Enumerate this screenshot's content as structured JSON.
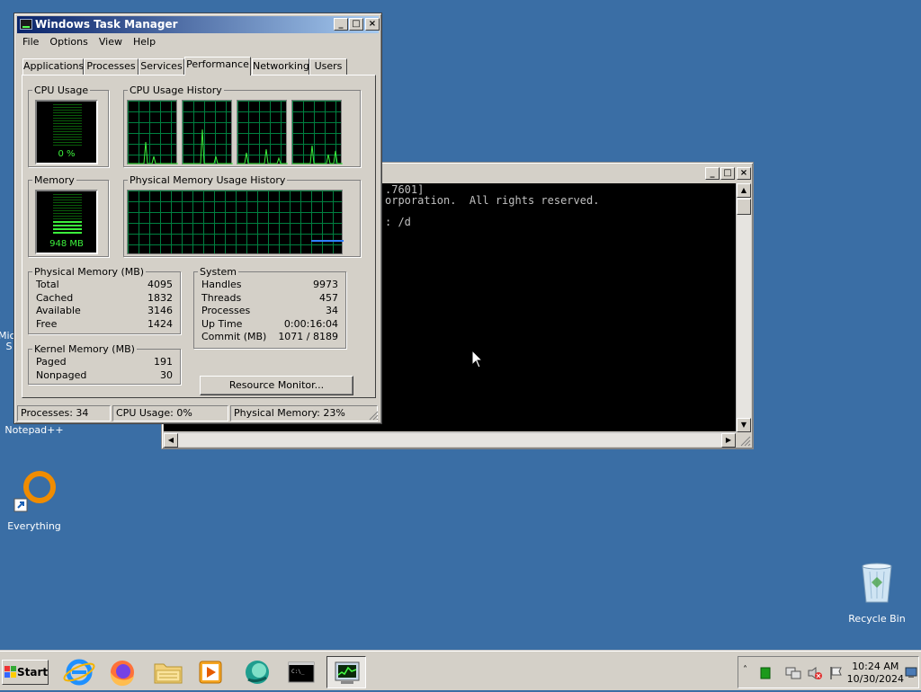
{
  "desktop": {
    "icons": [
      {
        "label": "Notepad++",
        "partial": true
      },
      {
        "label": "Everything"
      },
      {
        "label": "Recycle Bin"
      }
    ],
    "cut_off_left_labels": [
      "Mic",
      "S"
    ]
  },
  "cmd_window": {
    "lines": [
      ".7601]",
      "orporation.  All rights reserved.",
      "",
      ": /d"
    ]
  },
  "task_manager": {
    "title": "Windows Task Manager",
    "menu": [
      "File",
      "Options",
      "View",
      "Help"
    ],
    "tabs": [
      "Applications",
      "Processes",
      "Services",
      "Performance",
      "Networking",
      "Users"
    ],
    "active_tab": "Performance",
    "cpu_usage": {
      "title": "CPU Usage",
      "value_label": "0 %",
      "level": 0
    },
    "cpu_history": {
      "title": "CPU Usage History"
    },
    "memory": {
      "title": "Memory",
      "value_label": "948 MB",
      "level": 0.23
    },
    "mem_history": {
      "title": "Physical Memory Usage History"
    },
    "physical_memory": {
      "title": "Physical Memory (MB)",
      "rows": [
        {
          "label": "Total",
          "value": "4095"
        },
        {
          "label": "Cached",
          "value": "1832"
        },
        {
          "label": "Available",
          "value": "3146"
        },
        {
          "label": "Free",
          "value": "1424"
        }
      ]
    },
    "kernel_memory": {
      "title": "Kernel Memory (MB)",
      "rows": [
        {
          "label": "Paged",
          "value": "191"
        },
        {
          "label": "Nonpaged",
          "value": "30"
        }
      ]
    },
    "system": {
      "title": "System",
      "rows": [
        {
          "label": "Handles",
          "value": "9973"
        },
        {
          "label": "Threads",
          "value": "457"
        },
        {
          "label": "Processes",
          "value": "34"
        },
        {
          "label": "Up Time",
          "value": "0:00:16:04"
        },
        {
          "label": "Commit (MB)",
          "value": "1071 / 8189"
        }
      ]
    },
    "resource_monitor_button": "Resource Monitor...",
    "status": {
      "processes": "Processes: 34",
      "cpu": "CPU Usage: 0%",
      "memory": "Physical Memory: 23%"
    }
  },
  "taskbar": {
    "start_label": "Start",
    "apps": [
      "internet-explorer",
      "firefox",
      "file-explorer",
      "media-player",
      "browser",
      "command-prompt",
      "task-manager"
    ],
    "clock_time": "10:24 AM",
    "clock_date": "10/30/2024"
  },
  "colors": {
    "desktop": "#3a6ea5",
    "graph_grid": "#008040",
    "graph_line": "#3cf03c",
    "title_start": "#0a246a"
  }
}
